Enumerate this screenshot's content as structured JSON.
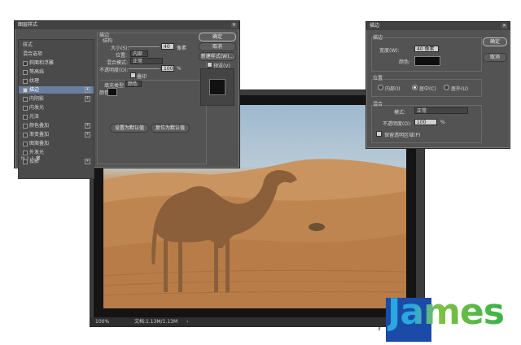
{
  "layer_style": {
    "title": "图层样式",
    "close": "✕",
    "list_items": [
      {
        "label": "样式",
        "checked": null,
        "plus": false
      },
      {
        "label": "混合选项",
        "checked": null,
        "plus": false
      },
      {
        "label": "斜面和浮雕",
        "checked": false,
        "plus": false
      },
      {
        "label": "等高线",
        "checked": false,
        "plus": false
      },
      {
        "label": "纹理",
        "checked": false,
        "plus": false
      },
      {
        "label": "描边",
        "checked": true,
        "plus": true,
        "active": true
      },
      {
        "label": "内阴影",
        "checked": false,
        "plus": true
      },
      {
        "label": "内发光",
        "checked": false,
        "plus": false
      },
      {
        "label": "光泽",
        "checked": false,
        "plus": false
      },
      {
        "label": "颜色叠加",
        "checked": false,
        "plus": true
      },
      {
        "label": "渐变叠加",
        "checked": false,
        "plus": true
      },
      {
        "label": "图案叠加",
        "checked": false,
        "plus": false
      },
      {
        "label": "外发光",
        "checked": false,
        "plus": false
      },
      {
        "label": "投影",
        "checked": false,
        "plus": true
      }
    ],
    "bottom_icons": "fx  ⇧  ⇩  🗑",
    "section_title": "描边",
    "structure": "结构",
    "size_label": "大小(S):",
    "size_value": "40",
    "size_unit": "像素",
    "position_label": "位置:",
    "position_value": "内部",
    "blend_label": "混合模式:",
    "blend_value": "正常",
    "opacity_label": "不透明度(O):",
    "opacity_value": "100",
    "opacity_unit": "%",
    "overprint_label": "叠印",
    "fill_type_label": "填充类型:",
    "fill_type_value": "颜色",
    "color_label": "颜色:",
    "default_btn": "设置为默认值",
    "reset_btn": "复位为默认值",
    "ok": "确定",
    "cancel": "取消",
    "new_style": "新建样式(W)...",
    "preview": "预览(V)"
  },
  "stroke": {
    "title": "描边",
    "close": "✕",
    "section_stroke": "描边",
    "width_label": "宽度(W):",
    "width_value": "40 像素",
    "color_label": "颜色:",
    "ok": "确定",
    "cancel": "取消",
    "section_position": "位置",
    "inside": "内部(I)",
    "center": "居中(C)",
    "outside": "居外(U)",
    "section_blend": "混合",
    "mode_label": "模式:",
    "mode_value": "正常",
    "opacity_label": "不透明度(O):",
    "opacity_value": "100",
    "opacity_unit": "%",
    "preserve_label": "保留透明区域(P)"
  },
  "document": {
    "zoom": "100%",
    "doc_info": "文档:1.13M/1.13M",
    "arrow": "›"
  },
  "logo": {
    "text": "James"
  },
  "colors": {
    "dialog_bg": "#535353",
    "active_item": "#6a7ea0",
    "stroke_color": "#0f0f0f"
  }
}
